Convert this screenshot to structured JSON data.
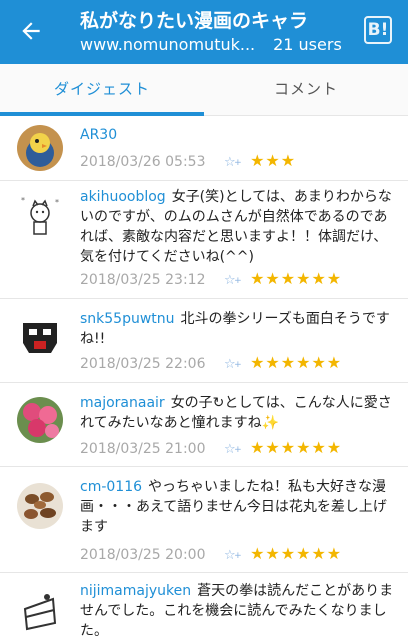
{
  "header": {
    "title": "私がなりたい漫画のキャラ",
    "url": "www.nomunomutuk...",
    "users": "21 users",
    "b_label": "B!"
  },
  "tabs": [
    {
      "label": "ダイジェスト"
    },
    {
      "label": "コメント"
    }
  ],
  "comments": [
    {
      "user": "AR30",
      "text": "",
      "date": "2018/03/26 05:53",
      "stars": "★★★"
    },
    {
      "user": "akihuooblog",
      "text": "女子(笑)としては、あまりわからないのですが、のムのムさんが自然体であるのであれば、素敵な内容だと思いますよ！！体調だけ、気を付けてくださいね(^^)",
      "date": "2018/03/25 23:12",
      "stars": "★★★★★★"
    },
    {
      "user": "snk55puwtnu",
      "text": "北斗の拳シリーズも面白そうですね!!",
      "date": "2018/03/25 22:06",
      "stars": "★★★★★★"
    },
    {
      "user": "majoranaair",
      "text": "女の子↻としては、こんな人に愛されてみたいなあと憧れますね✨",
      "date": "2018/03/25 21:00",
      "stars": "★★★★★★"
    },
    {
      "user": "cm-0116",
      "text": "やっちゃいましたね！私も大好きな漫画・・・あえて語りません今日は花丸を差し上げます",
      "date": "2018/03/25 20:00",
      "stars": "★★★★★★"
    },
    {
      "user": "nijimamajyuken",
      "text": "蒼天の拳は読んだことがありませんでした。これを機会に読んでみたくなりました。",
      "date": "",
      "stars": ""
    }
  ],
  "colors": {
    "primary": "#1f8fd6",
    "star": "#f3b600",
    "meta": "#a8a8a8"
  }
}
